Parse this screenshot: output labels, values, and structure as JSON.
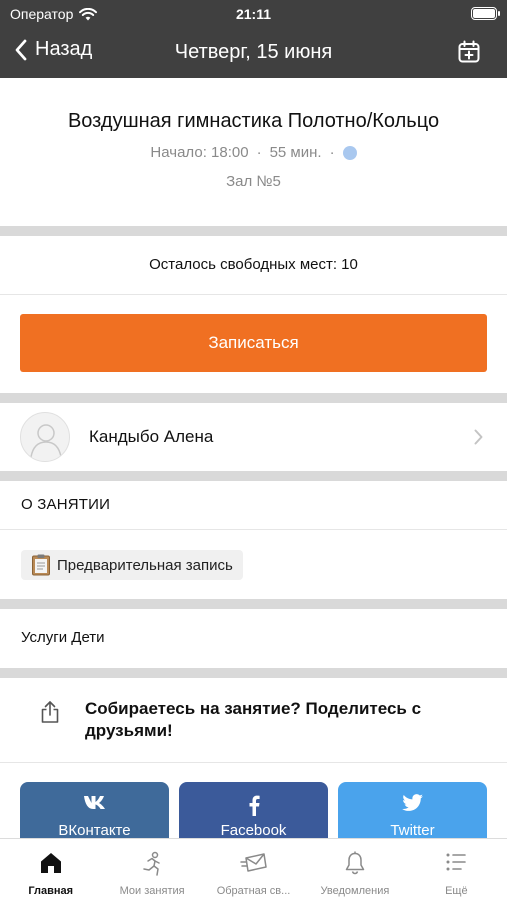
{
  "status_bar": {
    "carrier": "Оператор",
    "time": "21:11"
  },
  "nav": {
    "back_label": "Назад",
    "title": "Четверг, 15 июня",
    "calendar_icon": "calendar-plus-icon"
  },
  "class_info": {
    "title": "Воздушная гимнастика Полотно/Кольцо",
    "start": "Начало: 18:00",
    "separator": "·",
    "duration": "55 мин.",
    "room": "Зал №5",
    "dot_color": "#a9c8ef"
  },
  "seats_text": "Осталось свободных мест: 10",
  "signup_button": "Записаться",
  "signup_color": "#f07022",
  "trainer": {
    "name": "Кандыбо Алена"
  },
  "about": {
    "heading": "О ЗАНЯТИИ",
    "chip_label": "Предварительная запись",
    "chip_icon": "clipboard-icon"
  },
  "services": "Услуги Дети",
  "share": {
    "text": "Собираетесь на занятие? Поделитесь с друзьями!",
    "icon": "share-icon"
  },
  "social_buttons": [
    {
      "label": "ВКонтакте",
      "icon": "vk-icon",
      "color": "#3f6a9a"
    },
    {
      "label": "Facebook",
      "icon": "facebook-icon",
      "color": "#3b5a9a"
    },
    {
      "label": "Twitter",
      "icon": "twitter-icon",
      "color": "#4aa3ec"
    }
  ],
  "tabs": [
    {
      "label": "Главная",
      "icon": "home-icon",
      "active": true
    },
    {
      "label": "Мои занятия",
      "icon": "runner-icon",
      "active": false
    },
    {
      "label": "Обратная св...",
      "icon": "feedback-icon",
      "active": false
    },
    {
      "label": "Уведомления",
      "icon": "bell-icon",
      "active": false
    },
    {
      "label": "Ещё",
      "icon": "more-list-icon",
      "active": false
    }
  ]
}
